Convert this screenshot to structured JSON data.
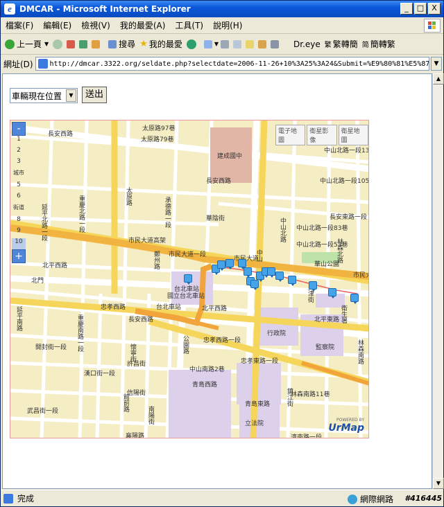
{
  "window": {
    "title": "DMCAR - Microsoft Internet Explorer"
  },
  "title_buttons": {
    "minimize": "_",
    "maximize": "□",
    "close": "X"
  },
  "menu": [
    "檔案(F)",
    "編輯(E)",
    "檢視(V)",
    "我的最愛(A)",
    "工具(T)",
    "說明(H)"
  ],
  "toolbar": {
    "back": "上一頁",
    "search": "搜尋",
    "favorites": "我的最愛",
    "dreye": "Dr.eye",
    "to_trad": "繁轉簡",
    "to_simp": "簡轉繁"
  },
  "address": {
    "label": "網址(D)",
    "url": "http://dmcar.3322.org/seldate.php?selectdate=2006-11-26+10%3A25%3A24&Submit=%E9%80%81%E5%87%BA"
  },
  "page": {
    "vehicle_select": "車輛現在位置",
    "submit_button": "送出"
  },
  "map": {
    "type_buttons": [
      "電子地圖",
      "衛星影像",
      "衛星地圖"
    ],
    "zoom_levels": [
      "1",
      "2",
      "3",
      "4",
      "5",
      "6",
      "7",
      "8",
      "9",
      "10"
    ],
    "zoom_words": {
      "city": "城市",
      "street": "街道"
    },
    "zoom_in": "+",
    "zoom_out": "-",
    "streets": {
      "s1": "長安西路",
      "s2": "太原路97巷",
      "s3": "太原路79巷",
      "s4": "建成國中",
      "s5": "中山北路一段135巷",
      "s6": "長安西路",
      "s7": "中山北路一段105巷",
      "s8": "華陰街",
      "s9": "長安東路一段",
      "s10": "中山北路一段83巷",
      "s11": "中山北路一段53巷",
      "s12": "市民大道高架",
      "s13": "市民大道一段",
      "s14": "市民大道",
      "s15": "華山公園",
      "s16": "北平西路",
      "s17": "台北車站",
      "s18": "北平西路",
      "s19": "北平東路",
      "s20": "忠孝西路一段",
      "s21": "行政院",
      "s22": "監察院",
      "s23": "中山南路2巷",
      "s24": "忠孝東路一段",
      "s25": "青島西路",
      "s26": "青島東路",
      "s27": "林森南路11巷",
      "s28": "立法院",
      "s29": "濟南路一段",
      "s30": "延平北路一段",
      "s31": "延平南路",
      "s32": "重慶南路一段",
      "s33": "開封街一段",
      "s34": "漢口街一段",
      "s35": "武昌街一段",
      "s36": "許昌街",
      "s37": "信陽街",
      "s38": "館前路",
      "s39": "南陽街",
      "s40": "襄陽路",
      "s41": "重慶北路一段",
      "s42": "承德路一段",
      "s43": "太原路",
      "s44": "鄭州路",
      "s45": "衛生署",
      "s46": "林森北路",
      "s47": "市民大道",
      "s48": "天津街",
      "s49": "公園路",
      "s50": "中山北路",
      "s51": "鎮江街",
      "s52": "林森南路",
      "s53": "長安西路",
      "s54": "台北車站",
      "s55": "國立台北車站",
      "s56": "忠孝西路",
      "s57": "中山",
      "s58": "懷寧街",
      "s59": "北門"
    },
    "logo": {
      "small": "POWERED BY",
      "big": "UrMap"
    }
  },
  "status": {
    "text": "完成",
    "zone": "網際網路"
  },
  "watermark": "#416445"
}
